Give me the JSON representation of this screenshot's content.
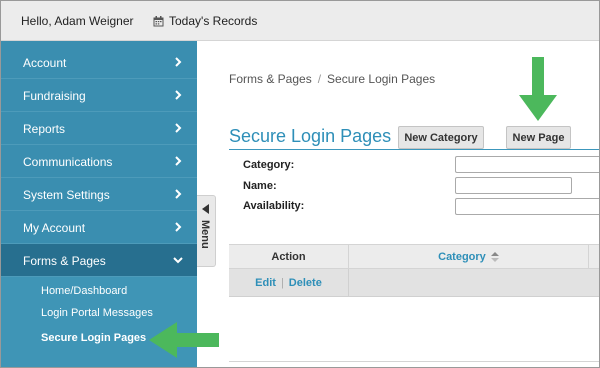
{
  "topbar": {
    "greeting": "Hello, Adam Weigner",
    "records_label": "Today's Records",
    "records_icon": "calendar-icon"
  },
  "sidebar": {
    "items": [
      {
        "label": "Account"
      },
      {
        "label": "Fundraising"
      },
      {
        "label": "Reports"
      },
      {
        "label": "Communications"
      },
      {
        "label": "System Settings"
      },
      {
        "label": "My Account"
      },
      {
        "label": "Forms & Pages"
      }
    ],
    "active_item": "Forms & Pages",
    "subitems": [
      {
        "label": "Home/Dashboard"
      },
      {
        "label": "Login Portal Messages"
      },
      {
        "label": "Secure Login Pages"
      }
    ],
    "current_subitem": "Secure Login Pages",
    "menu_tab_label": "Menu"
  },
  "breadcrumb": {
    "items": [
      "Forms & Pages",
      "Secure Login Pages"
    ],
    "separator": "/"
  },
  "page": {
    "title": "Secure Login Pages",
    "new_category_label": "New Category",
    "new_page_label": "New Page"
  },
  "filters": {
    "category_label": "Category:",
    "name_label": "Name:",
    "availability_label": "Availability:"
  },
  "table": {
    "columns": [
      "Action",
      "Category"
    ],
    "rows": [
      {
        "edit": "Edit",
        "delete": "Delete"
      }
    ]
  },
  "colors": {
    "sidebar": "#3a8eb0",
    "sidebar_active": "#276f8f",
    "accent": "#2e8fb8",
    "annotation_arrow": "#4cb85c"
  }
}
